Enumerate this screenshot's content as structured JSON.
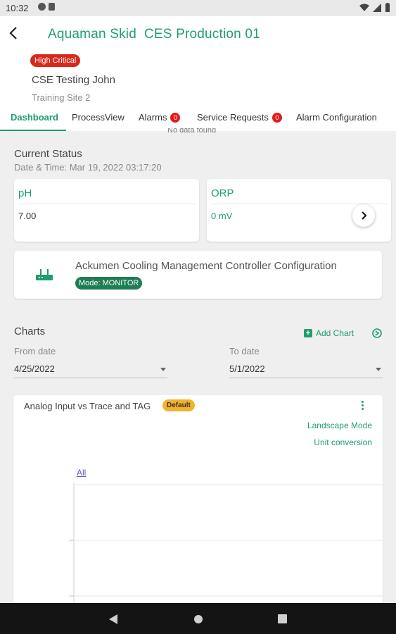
{
  "status_bar": {
    "time": "10:32"
  },
  "header": {
    "title": "Aquaman Skid  CES Production 01",
    "severity_badge": "High Critical",
    "user": "CSE Testing John",
    "site": "Training Site 2"
  },
  "tabs": [
    {
      "label": "Dashboard",
      "active": true
    },
    {
      "label": "ProcessView"
    },
    {
      "label": "Alarms",
      "count": "0"
    },
    {
      "label": "Service Requests",
      "count": "0"
    },
    {
      "label": "Alarm Configuration"
    }
  ],
  "no_data_text": "No data found",
  "current_status": {
    "title": "Current Status",
    "datetime": "Date & Time: Mar 19, 2022 03:17:20",
    "cards": [
      {
        "title": "pH",
        "value": "7.00"
      },
      {
        "title": "ORP",
        "value": "0 mV"
      }
    ]
  },
  "controller": {
    "title": "Ackumen Cooling Management Controller Configuration",
    "mode": "Mode: MONITOR"
  },
  "charts": {
    "title": "Charts",
    "add_label": "Add Chart",
    "from_label": "From date",
    "from_value": "4/25/2022",
    "to_label": "To date",
    "to_value": "5/1/2022",
    "chart": {
      "title": "Analog Input vs Trace and TAG",
      "badge": "Default",
      "landscape": "Landscape Mode",
      "unit_conversion": "Unit conversion",
      "legend_all": "All"
    }
  },
  "colors": {
    "accent": "#1e9e6c",
    "critical": "#d9291c",
    "default_badge": "#f2b329"
  }
}
